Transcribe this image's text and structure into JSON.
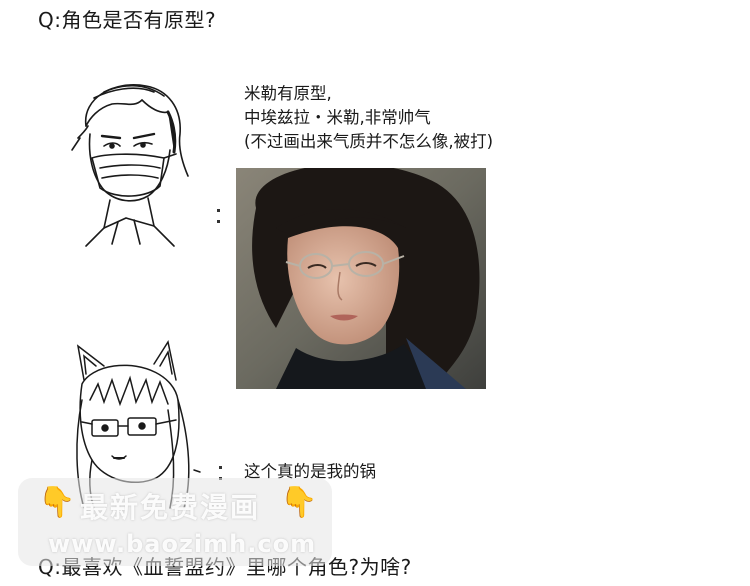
{
  "question1": "Q:角色是否有原型?",
  "answer": {
    "line1": "米勒有原型,",
    "line2": "中埃兹拉・米勒,非常帅气",
    "line3": "(不过画出来气质并不怎么像,被打)"
  },
  "caption": "这个真的是我的锅",
  "question2": "Q:最喜欢《血誓盟约》里哪个角色?为啥?",
  "watermark": {
    "line1": "最新免费漫画",
    "line2": "www.baozimh.com",
    "hand_icon": "pointing-down-hand-icon"
  }
}
